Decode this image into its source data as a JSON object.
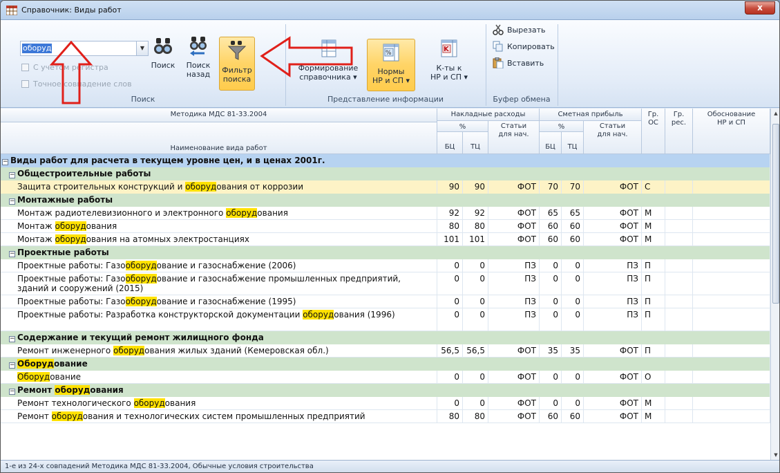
{
  "window": {
    "title": "Справочник: Виды работ",
    "close_label": "x"
  },
  "ribbon": {
    "search": {
      "value": "оборуд",
      "case_label": "С учетом регистра",
      "exact_label": "Точное совпадение слов",
      "find_label": "Поиск",
      "find_back_label_1": "Поиск",
      "find_back_label_2": "назад",
      "filter_label_1": "Фильтр",
      "filter_label_2": "поиска",
      "group_label": "Поиск"
    },
    "view": {
      "formation_label_1": "Формирование",
      "formation_label_2": "справочника",
      "norms_label_1": "Нормы",
      "norms_label_2": "НР и СП",
      "coef_label_1": "К-ты к",
      "coef_label_2": "НР и СП",
      "group_label": "Представление информации"
    },
    "clipboard": {
      "cut_label": "Вырезать",
      "copy_label": "Копировать",
      "paste_label": "Вставить",
      "group_label": "Буфер обмена"
    }
  },
  "grid": {
    "headers": {
      "method": "Методика МДС 81-33.2004",
      "name": "Наименование вида работ",
      "overhead": "Накладные расходы",
      "profit": "Сметная прибыль",
      "percent": "%",
      "basis_items": "Статьи для нач.",
      "bc": "БЦ",
      "tc": "ТЦ",
      "gr_os": "Гр. ОС",
      "gr_res": "Гр. рес.",
      "justification": "Обоснование НР и СП"
    },
    "rows": [
      {
        "type": "lvl0",
        "pre": "Виды работ для расчета в текущем уровне цен, и в ценах 2001г.",
        "hl": "",
        "post": ""
      },
      {
        "type": "grp",
        "pre": "Общестроительные работы",
        "hl": "",
        "post": ""
      },
      {
        "type": "sel",
        "pre": "Защита строительных конструкций и ",
        "hl": "оборуд",
        "post": "ования от коррозии",
        "nr_bc": "90",
        "nr_tc": "90",
        "nr_st": "ФОТ",
        "sp_bc": "70",
        "sp_tc": "70",
        "sp_st": "ФОТ",
        "gr": "С"
      },
      {
        "type": "grp",
        "pre": "Монтажные работы",
        "hl": "",
        "post": ""
      },
      {
        "type": "data",
        "pre": "Монтаж радиотелевизионного и электронного ",
        "hl": "оборуд",
        "post": "ования",
        "nr_bc": "92",
        "nr_tc": "92",
        "nr_st": "ФОТ",
        "sp_bc": "65",
        "sp_tc": "65",
        "sp_st": "ФОТ",
        "gr": "М"
      },
      {
        "type": "data",
        "pre": "Монтаж ",
        "hl": "оборуд",
        "post": "ования",
        "nr_bc": "80",
        "nr_tc": "80",
        "nr_st": "ФОТ",
        "sp_bc": "60",
        "sp_tc": "60",
        "sp_st": "ФОТ",
        "gr": "М"
      },
      {
        "type": "data",
        "pre": "Монтаж ",
        "hl": "оборуд",
        "post": "ования на атомных электростанциях",
        "nr_bc": "101",
        "nr_tc": "101",
        "nr_st": "ФОТ",
        "sp_bc": "60",
        "sp_tc": "60",
        "sp_st": "ФОТ",
        "gr": "М"
      },
      {
        "type": "grp",
        "pre": "Проектные работы",
        "hl": "",
        "post": ""
      },
      {
        "type": "data",
        "pre": "Проектные работы: Газо",
        "hl": "оборуд",
        "post": "ование и газоснабжение (2006)",
        "nr_bc": "0",
        "nr_tc": "0",
        "nr_st": "ПЗ",
        "sp_bc": "0",
        "sp_tc": "0",
        "sp_st": "ПЗ",
        "gr": "П"
      },
      {
        "type": "data tall",
        "pre": "Проектные работы: Газо",
        "hl": "оборуд",
        "post": "ование и газоснабжение промышленных предприятий, зданий и сооружений (2015)",
        "nr_bc": "0",
        "nr_tc": "0",
        "nr_st": "ПЗ",
        "sp_bc": "0",
        "sp_tc": "0",
        "sp_st": "ПЗ",
        "gr": "П"
      },
      {
        "type": "data",
        "pre": "Проектные работы: Газо",
        "hl": "оборуд",
        "post": "ование и газоснабжение (1995)",
        "nr_bc": "0",
        "nr_tc": "0",
        "nr_st": "ПЗ",
        "sp_bc": "0",
        "sp_tc": "0",
        "sp_st": "ПЗ",
        "gr": "П"
      },
      {
        "type": "data tall",
        "pre": "Проектные работы: Разработка конструкторской документации ",
        "hl": "оборуд",
        "post": "ования (1996)",
        "nr_bc": "0",
        "nr_tc": "0",
        "nr_st": "ПЗ",
        "sp_bc": "0",
        "sp_tc": "0",
        "sp_st": "ПЗ",
        "gr": "П"
      },
      {
        "type": "grp",
        "pre": "Содержание и текущий ремонт жилищного фонда",
        "hl": "",
        "post": ""
      },
      {
        "type": "data",
        "pre": "Ремонт инженерного ",
        "hl": "оборуд",
        "post": "ования жилых зданий (Кемеровская обл.)",
        "nr_bc": "56,5",
        "nr_tc": "56,5",
        "nr_st": "ФОТ",
        "sp_bc": "35",
        "sp_tc": "35",
        "sp_st": "ФОТ",
        "gr": "П"
      },
      {
        "type": "grp",
        "pre": "",
        "hl": "Оборуд",
        "post": "ование"
      },
      {
        "type": "data",
        "pre": "",
        "hl": "Оборуд",
        "post": "ование",
        "nr_bc": "0",
        "nr_tc": "0",
        "nr_st": "ФОТ",
        "sp_bc": "0",
        "sp_tc": "0",
        "sp_st": "ФОТ",
        "gr": "О"
      },
      {
        "type": "grp",
        "pre": "Ремонт ",
        "hl": "оборуд",
        "post": "ования"
      },
      {
        "type": "data",
        "pre": "Ремонт технологического ",
        "hl": "оборуд",
        "post": "ования",
        "nr_bc": "0",
        "nr_tc": "0",
        "nr_st": "ФОТ",
        "sp_bc": "0",
        "sp_tc": "0",
        "sp_st": "ФОТ",
        "gr": "М"
      },
      {
        "type": "data",
        "pre": "Ремонт ",
        "hl": "оборуд",
        "post": "ования и технологических систем промышленных предприятий",
        "nr_bc": "80",
        "nr_tc": "80",
        "nr_st": "ФОТ",
        "sp_bc": "60",
        "sp_tc": "60",
        "sp_st": "ФОТ",
        "gr": "М"
      }
    ]
  },
  "status": {
    "text": "1-е из 24-х совпадений  Методика МДС 81-33.2004, Обычные условия строительства"
  },
  "colors": {
    "highlight": "#ffe100",
    "group_row": "#cfe4cc",
    "root_row": "#b7d3f1",
    "selected_row": "#fdf3c6",
    "active_button": "#ffd466",
    "annotation_arrow": "#e0201a"
  },
  "icons": {
    "app": "grid-table-icon",
    "find": "binoculars-icon",
    "find_back": "binoculars-back-icon",
    "filter": "funnel-icon",
    "formation": "table-icon",
    "norms": "percent-table-icon",
    "coef": "k-table-icon",
    "cut": "scissors-icon",
    "copy": "copy-icon",
    "paste": "paste-icon"
  }
}
